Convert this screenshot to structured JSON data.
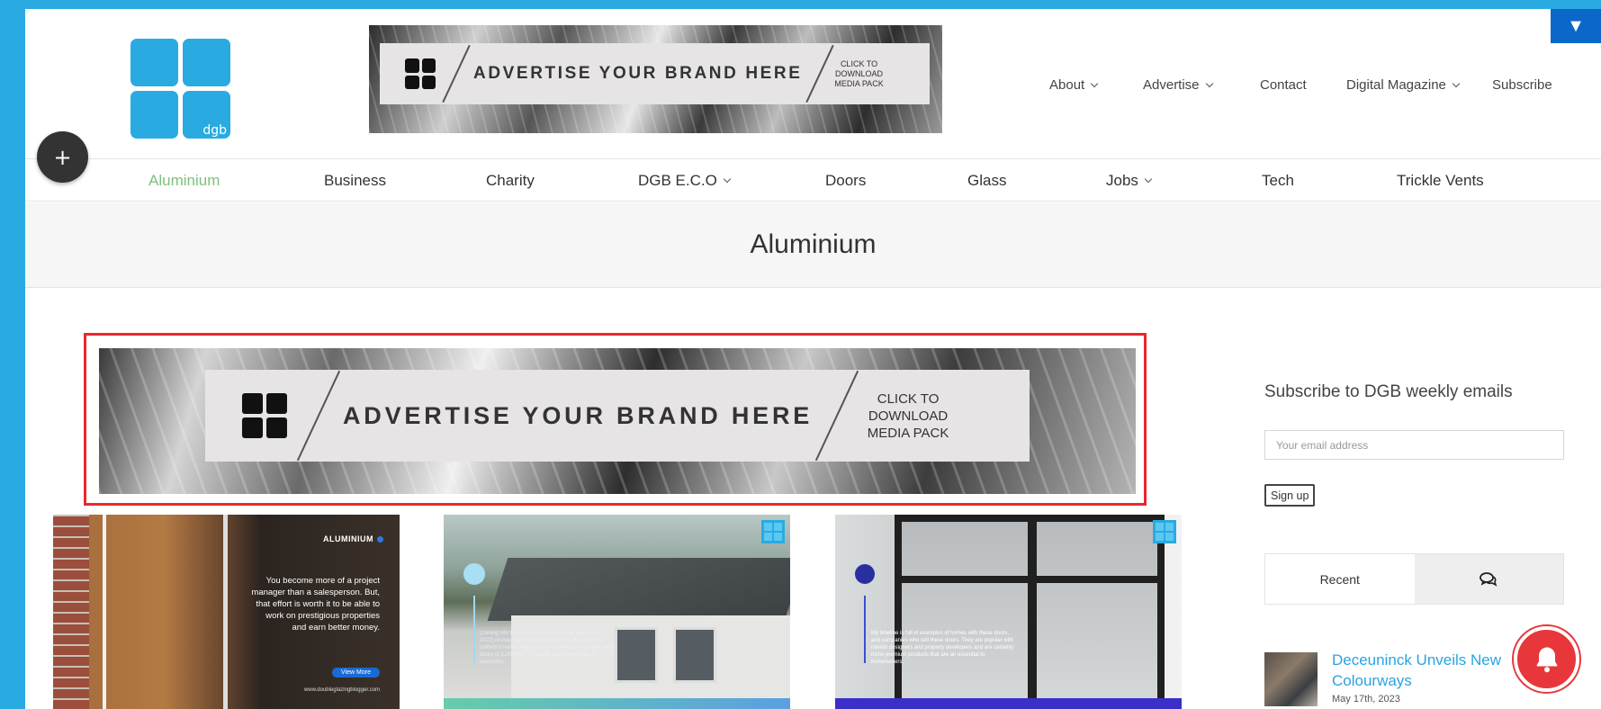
{
  "logo": {
    "text": "dgb"
  },
  "header_ad": {
    "headline": "ADVERTISE YOUR BRAND HERE",
    "cta": "CLICK TO\nDOWNLOAD\nMEDIA PACK"
  },
  "top_nav": [
    {
      "label": "About",
      "has_dropdown": true
    },
    {
      "label": "Advertise",
      "has_dropdown": true
    },
    {
      "label": "Contact",
      "has_dropdown": false
    },
    {
      "label": "Digital Magazine",
      "has_dropdown": true
    },
    {
      "label": "Subscribe",
      "has_dropdown": false
    }
  ],
  "toggle_icon": "▼",
  "plus_icon": "+",
  "category_nav": [
    {
      "label": "Aluminium",
      "active": true
    },
    {
      "label": "Business"
    },
    {
      "label": "Charity"
    },
    {
      "label": "DGB E.C.O",
      "has_dropdown": true
    },
    {
      "label": "Doors"
    },
    {
      "label": "Glass"
    },
    {
      "label": "Jobs",
      "has_dropdown": true
    },
    {
      "label": "Tech"
    },
    {
      "label": "Trickle Vents"
    }
  ],
  "page_title": "Aluminium",
  "main_ad": {
    "headline": "ADVERTISE YOUR BRAND HERE",
    "cta": "CLICK TO\nDOWNLOAD\nMEDIA PACK"
  },
  "posts": [
    {
      "tag": "ALUMINIUM",
      "quote": "You become more of a project manager than a salesperson. But, that effort is worth it to be able to work on prestigious properties and earn better money.",
      "button": "View More",
      "site": "www.doubleglazingblogger.com"
    },
    {
      "text": "Coming into force almost exactly a year ago (June 2022) revised Part L building regs introduced a new uniform U-value requirement for new build windows and doors of 1.2W/m2K – but with a 12-month stay of execution."
    },
    {
      "text": "My timeline is full of examples of homes with these doors, and companies who sell these doors. They are popular with interior designers and property developers and are certainly niche premium products that are an essential to homeowners."
    }
  ],
  "sidebar": {
    "subscribe_title": "Subscribe to DGB weekly emails",
    "email_placeholder": "Your email address",
    "signup_label": "Sign up",
    "tabs": {
      "recent": "Recent",
      "comments_icon": "comments-icon"
    },
    "recent_post": {
      "title": "Deceuninck Unveils New Colourways",
      "date": "May 17th, 2023"
    }
  },
  "colors": {
    "brand_blue": "#29abe2",
    "active_green": "#7cc27c",
    "highlight_red": "#e8282e",
    "link_blue": "#2aa3e0",
    "notification_red": "#e8373a"
  }
}
